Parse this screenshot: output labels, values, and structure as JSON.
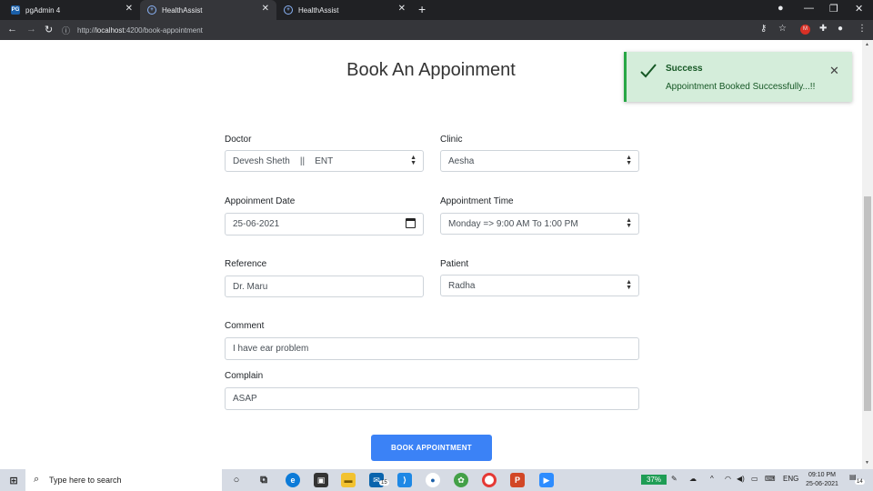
{
  "browser": {
    "tabs": [
      {
        "label": "pgAdmin 4",
        "favicon": "pgadmin-icon"
      },
      {
        "label": "HealthAssist",
        "favicon": "healthassist-icon",
        "active": true
      },
      {
        "label": "HealthAssist",
        "favicon": "healthassist-icon"
      }
    ],
    "url_prefix": "http://",
    "url_host": "localhost",
    "url_rest": ":4200/book-appointment"
  },
  "page": {
    "title": "Book An Appoinment",
    "form": {
      "doctor": {
        "label": "Doctor",
        "value": "Devesh Sheth    ||    ENT"
      },
      "clinic": {
        "label": "Clinic",
        "value": "Aesha"
      },
      "date": {
        "label": "Appoinment Date",
        "value": "25-06-2021"
      },
      "time": {
        "label": "Appointment Time",
        "value": "Monday => 9:00 AM To 1:00 PM"
      },
      "reference": {
        "label": "Reference",
        "value": "Dr. Maru"
      },
      "patient": {
        "label": "Patient",
        "value": "Radha"
      },
      "comment": {
        "label": "Comment",
        "value": "I have ear problem"
      },
      "complain": {
        "label": "Complain",
        "value": "ASAP"
      }
    },
    "submit_label": "BOOK APPOINTMENT"
  },
  "toast": {
    "title": "Success",
    "message": "Appointment Booked Successfully...!!"
  },
  "taskbar": {
    "search_placeholder": "Type here to search",
    "mail_badge": "15",
    "battery": "37%",
    "language": "ENG",
    "time": "09:10 PM",
    "date": "25-06-2021",
    "notification_count": "14"
  },
  "colors": {
    "primary_button": "#3b82f6",
    "toast_bg": "#d4edda",
    "toast_text": "#155724"
  }
}
